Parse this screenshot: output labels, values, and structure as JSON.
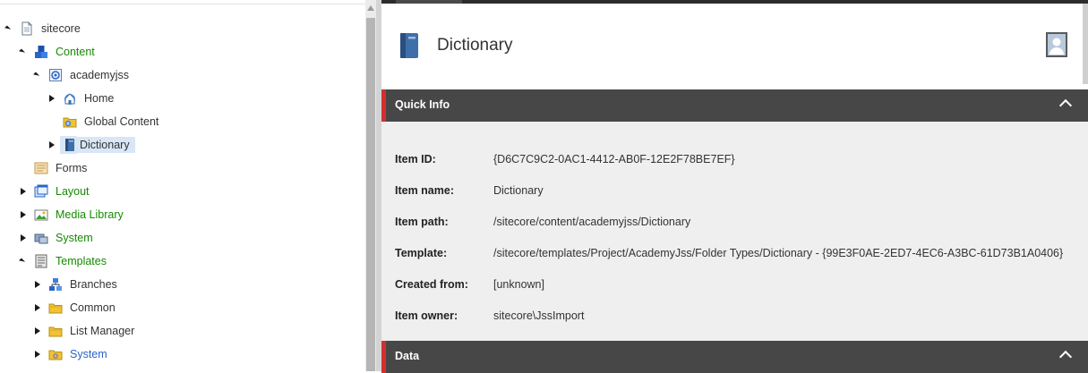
{
  "tree": {
    "items": [
      {
        "label": "sitecore",
        "expanded": true,
        "color": "gray",
        "icon": "document-icon"
      },
      {
        "label": "Content",
        "expanded": true,
        "color": "green",
        "icon": "content-cubes-icon"
      },
      {
        "label": "academyjss",
        "expanded": true,
        "color": "gray",
        "icon": "site-icon"
      },
      {
        "label": "Home",
        "expanded": false,
        "color": "gray",
        "icon": "home-icon"
      },
      {
        "label": "Global Content",
        "expanded": null,
        "color": "gray",
        "icon": "global-content-folder-icon"
      },
      {
        "label": "Dictionary",
        "expanded": false,
        "color": "gray",
        "icon": "dictionary-book-icon",
        "selected": true
      },
      {
        "label": "Forms",
        "expanded": null,
        "color": "gray",
        "icon": "forms-icon"
      },
      {
        "label": "Layout",
        "expanded": false,
        "color": "green",
        "icon": "layout-icon"
      },
      {
        "label": "Media Library",
        "expanded": false,
        "color": "green",
        "icon": "media-library-icon"
      },
      {
        "label": "System",
        "expanded": false,
        "color": "green",
        "icon": "system-icon"
      },
      {
        "label": "Templates",
        "expanded": true,
        "color": "green",
        "icon": "templates-icon"
      },
      {
        "label": "Branches",
        "expanded": false,
        "color": "gray",
        "icon": "branches-icon"
      },
      {
        "label": "Common",
        "expanded": false,
        "color": "gray",
        "icon": "folder-icon"
      },
      {
        "label": "List Manager",
        "expanded": false,
        "color": "gray",
        "icon": "folder-icon"
      },
      {
        "label": "System",
        "expanded": false,
        "color": "gray",
        "icon": "system-folder-icon"
      }
    ]
  },
  "editor": {
    "item_title": "Dictionary",
    "quick_info": {
      "title": "Quick Info",
      "fields": [
        {
          "label": "Item ID:",
          "value": "{D6C7C9C2-0AC1-4412-AB0F-12E2F78BE7EF}"
        },
        {
          "label": "Item name:",
          "value": "Dictionary"
        },
        {
          "label": "Item path:",
          "value": "/sitecore/content/academyjss/Dictionary"
        },
        {
          "label": "Template:",
          "value": "/sitecore/templates/Project/AcademyJss/Folder Types/Dictionary - {99E3F0AE-2ED7-4EC6-A3BC-61D73B1A0406}"
        },
        {
          "label": "Created from:",
          "value": "[unknown]"
        },
        {
          "label": "Item owner:",
          "value": "sitecore\\JssImport"
        }
      ]
    },
    "data_section": {
      "title": "Data"
    }
  },
  "colors": {
    "tree_green": "#158a00",
    "section_bar": "#474747",
    "section_accent": "#d32f2f",
    "selection": "#d8e6f6",
    "quickinfo_bg": "#efefef"
  }
}
